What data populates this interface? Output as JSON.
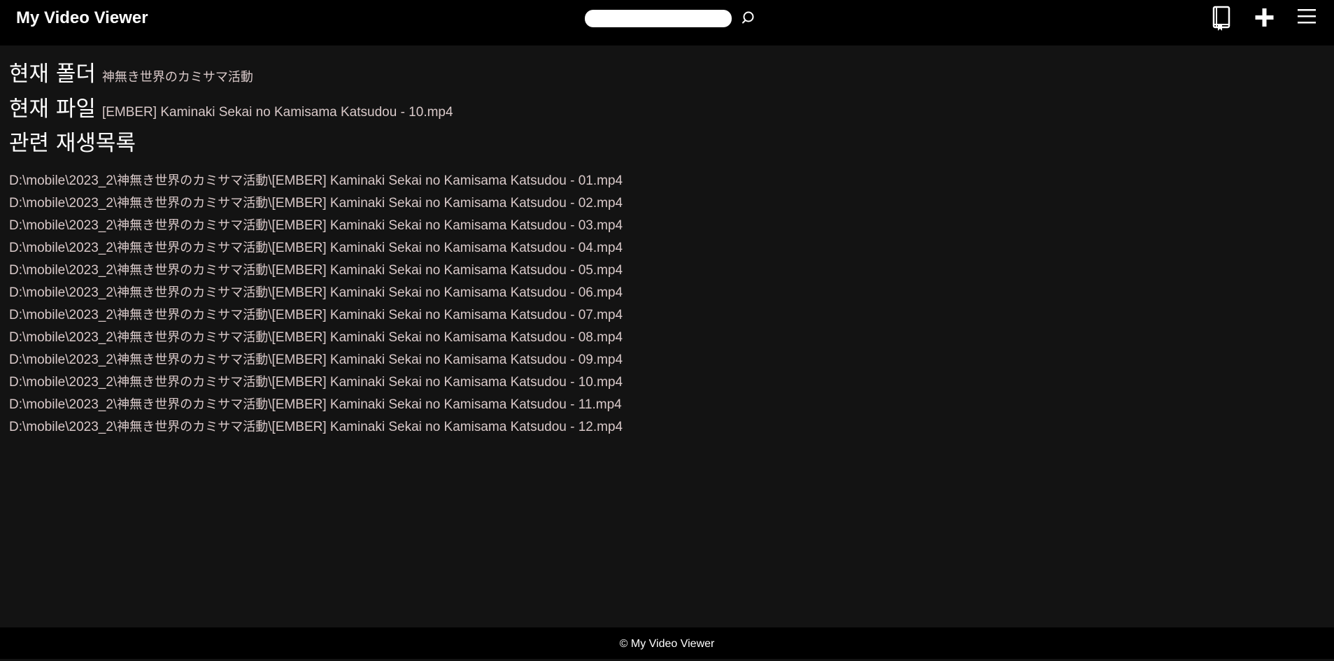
{
  "header": {
    "brand": "My Video Viewer",
    "search": {
      "value": "",
      "placeholder": ""
    },
    "icons": {
      "search": "search-icon",
      "bookmark": "bookmark-book-icon",
      "add": "plus-icon",
      "menu": "hamburger-menu-icon"
    }
  },
  "main": {
    "folder_label": "현재 폴더",
    "folder_value": "神無き世界のカミサマ活動",
    "file_label": "현재 파일",
    "file_value": "[EMBER] Kaminaki Sekai no Kamisama Katsudou - 10.mp4",
    "playlist_label": "관련 재생목록",
    "playlist": [
      {
        "prefix": "D:\\mobile\\2023_2\\",
        "folder": "神無き世界のカミサマ活動",
        "file": "\\[EMBER] Kaminaki Sekai no Kamisama Katsudou - 01.mp4"
      },
      {
        "prefix": "D:\\mobile\\2023_2\\",
        "folder": "神無き世界のカミサマ活動",
        "file": "\\[EMBER] Kaminaki Sekai no Kamisama Katsudou - 02.mp4"
      },
      {
        "prefix": "D:\\mobile\\2023_2\\",
        "folder": "神無き世界のカミサマ活動",
        "file": "\\[EMBER] Kaminaki Sekai no Kamisama Katsudou - 03.mp4"
      },
      {
        "prefix": "D:\\mobile\\2023_2\\",
        "folder": "神無き世界のカミサマ活動",
        "file": "\\[EMBER] Kaminaki Sekai no Kamisama Katsudou - 04.mp4"
      },
      {
        "prefix": "D:\\mobile\\2023_2\\",
        "folder": "神無き世界のカミサマ活動",
        "file": "\\[EMBER] Kaminaki Sekai no Kamisama Katsudou - 05.mp4"
      },
      {
        "prefix": "D:\\mobile\\2023_2\\",
        "folder": "神無き世界のカミサマ活動",
        "file": "\\[EMBER] Kaminaki Sekai no Kamisama Katsudou - 06.mp4"
      },
      {
        "prefix": "D:\\mobile\\2023_2\\",
        "folder": "神無き世界のカミサマ活動",
        "file": "\\[EMBER] Kaminaki Sekai no Kamisama Katsudou - 07.mp4"
      },
      {
        "prefix": "D:\\mobile\\2023_2\\",
        "folder": "神無き世界のカミサマ活動",
        "file": "\\[EMBER] Kaminaki Sekai no Kamisama Katsudou - 08.mp4"
      },
      {
        "prefix": "D:\\mobile\\2023_2\\",
        "folder": "神無き世界のカミサマ活動",
        "file": "\\[EMBER] Kaminaki Sekai no Kamisama Katsudou - 09.mp4"
      },
      {
        "prefix": "D:\\mobile\\2023_2\\",
        "folder": "神無き世界のカミサマ活動",
        "file": "\\[EMBER] Kaminaki Sekai no Kamisama Katsudou - 10.mp4"
      },
      {
        "prefix": "D:\\mobile\\2023_2\\",
        "folder": "神無き世界のカミサマ活動",
        "file": "\\[EMBER] Kaminaki Sekai no Kamisama Katsudou - 11.mp4"
      },
      {
        "prefix": "D:\\mobile\\2023_2\\",
        "folder": "神無き世界のカミサマ活動",
        "file": "\\[EMBER] Kaminaki Sekai no Kamisama Katsudou - 12.mp4"
      }
    ]
  },
  "footer": {
    "text": "© My Video Viewer"
  },
  "colors": {
    "background": "#131313",
    "bar": "#000000",
    "heading": "#ffffff",
    "text": "#d9c9c9"
  }
}
